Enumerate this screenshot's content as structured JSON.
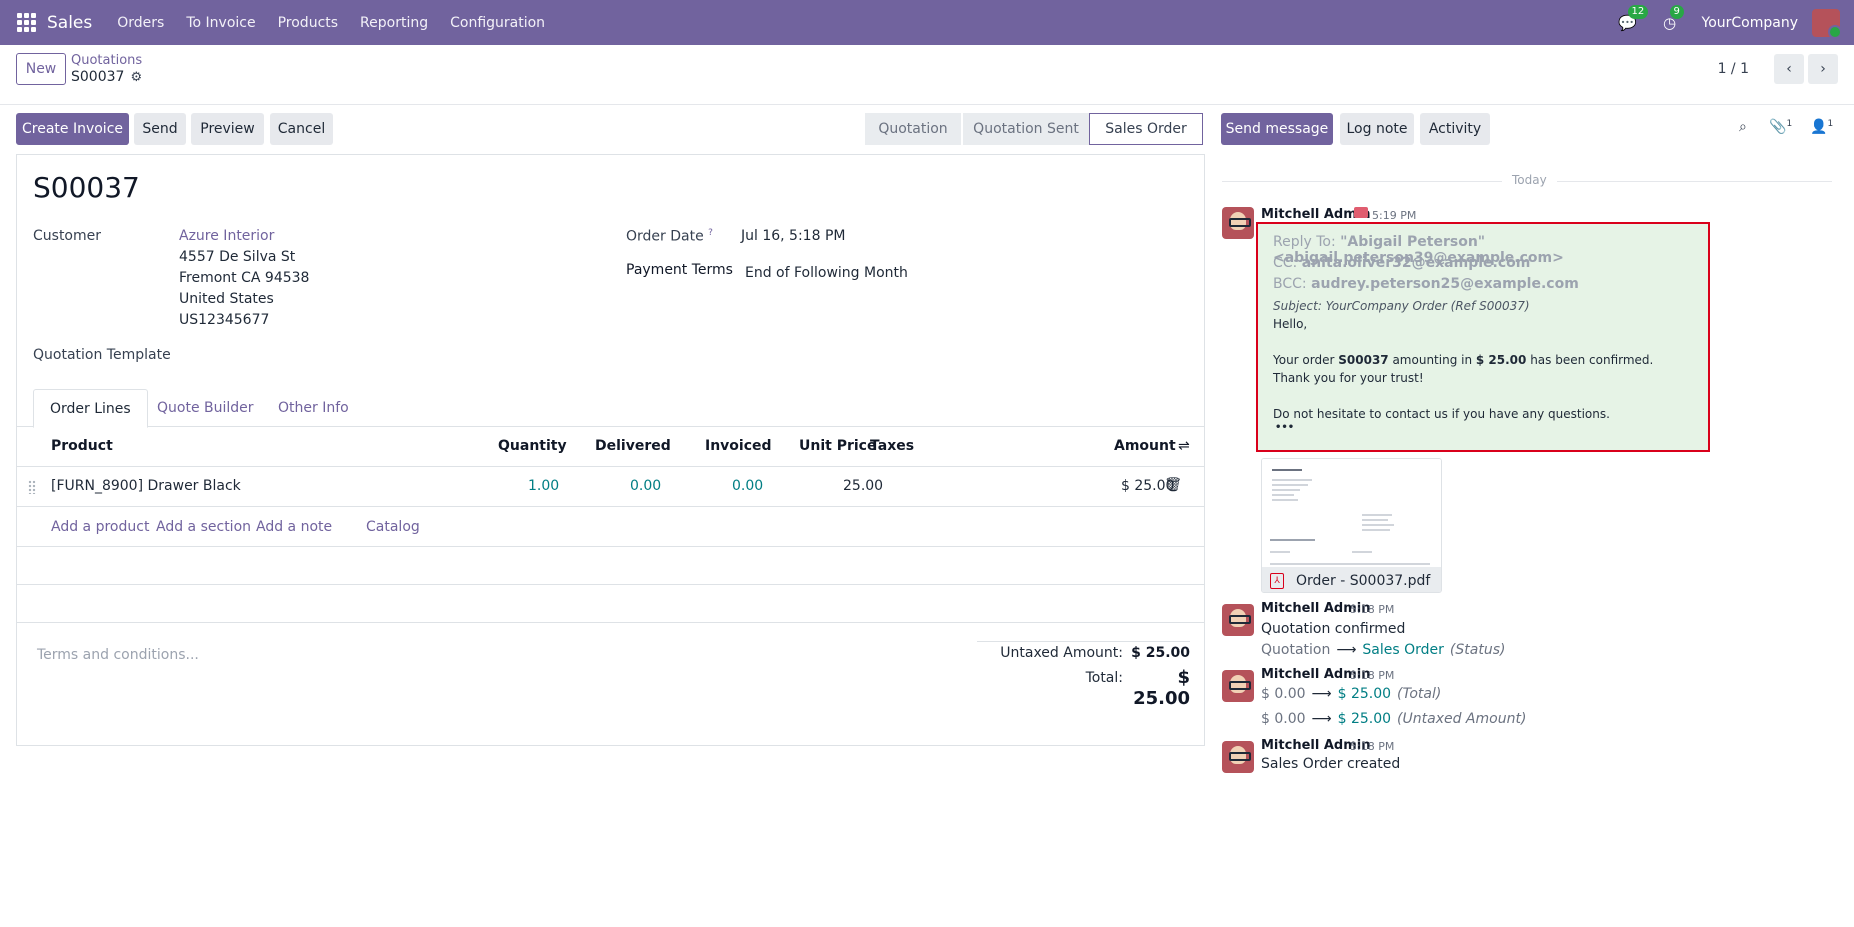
{
  "topbar": {
    "app_name": "Sales",
    "menu": [
      "Orders",
      "To Invoice",
      "Products",
      "Reporting",
      "Configuration"
    ],
    "messages_count": "12",
    "activities_count": "9",
    "company": "YourCompany"
  },
  "control": {
    "new_label": "New",
    "breadcrumb_parent": "Quotations",
    "breadcrumb_current": "S00037",
    "pager": "1 / 1"
  },
  "actions": {
    "create_invoice": "Create Invoice",
    "send": "Send",
    "preview": "Preview",
    "cancel": "Cancel"
  },
  "status": {
    "stages": [
      "Quotation",
      "Quotation Sent",
      "Sales Order"
    ],
    "active": "Sales Order"
  },
  "form": {
    "title": "S00037",
    "customer_label": "Customer",
    "customer_name": "Azure Interior",
    "address": [
      "4557 De Silva St",
      "Fremont CA 94538",
      "United States",
      "US12345677"
    ],
    "quotation_template_label": "Quotation Template",
    "order_date_label": "Order Date",
    "order_date_hint": "?",
    "order_date": "Jul 16, 5:18 PM",
    "payment_terms_label": "Payment Terms",
    "payment_terms": "End of Following Month"
  },
  "tabs": [
    "Order Lines",
    "Quote Builder",
    "Other Info"
  ],
  "order_lines": {
    "columns": [
      "Product",
      "Quantity",
      "Delivered",
      "Invoiced",
      "Unit Price",
      "Taxes",
      "Amount"
    ],
    "rows": [
      {
        "product": "[FURN_8900] Drawer Black",
        "quantity": "1.00",
        "delivered": "0.00",
        "invoiced": "0.00",
        "unit_price": "25.00",
        "taxes": "",
        "amount": "$ 25.00"
      }
    ],
    "add_links": [
      "Add a product",
      "Add a section",
      "Add a note",
      "Catalog"
    ]
  },
  "footer": {
    "terms_placeholder": "Terms and conditions...",
    "untaxed_label": "Untaxed Amount:",
    "untaxed_value": "$ 25.00",
    "total_label": "Total:",
    "total_value": "$ 25.00"
  },
  "chatter": {
    "send_message": "Send message",
    "log_note": "Log note",
    "activity": "Activity",
    "attachments_count": "1",
    "followers_count": "1",
    "today_label": "Today",
    "messages": [
      {
        "author": "Mitchell Admin",
        "time": "5:19 PM",
        "reply_to_label": "Reply To:",
        "reply_to": "\"Abigail Peterson\" <abigail.peterson39@example.com>",
        "cc_label": "CC:",
        "cc": "anita.oliver32@example.com",
        "bcc_label": "BCC:",
        "bcc": "audrey.peterson25@example.com",
        "subject": "Subject: YourCompany Order (Ref S00037)",
        "greeting": "Hello,",
        "line1_pre": "Your order ",
        "line1_order": "S00037",
        "line1_mid": " amounting in ",
        "line1_amount": "$ 25.00",
        "line1_post": " has been confirmed.",
        "line2": "Thank you for your trust!",
        "line3": "Do not hesitate to contact us if you have any questions.",
        "ellipsis": "•••",
        "attachment": "Order - S00037.pdf"
      },
      {
        "author": "Mitchell Admin",
        "time": "5:18 PM",
        "body": "Quotation confirmed",
        "track_old": "Quotation",
        "track_new": "Sales Order",
        "track_field": "(Status)"
      },
      {
        "author": "Mitchell Admin",
        "time": "5:18 PM",
        "tracks": [
          {
            "old": "$ 0.00",
            "new": "$ 25.00",
            "field": "(Total)"
          },
          {
            "old": "$ 0.00",
            "new": "$ 25.00",
            "field": "(Untaxed Amount)"
          }
        ]
      },
      {
        "author": "Mitchell Admin",
        "time": "5:18 PM",
        "body": "Sales Order created"
      }
    ]
  },
  "colors": {
    "brand": "#71639e",
    "link_teal": "#017e84",
    "highlight_border": "#d9001b",
    "mail_bg": "#e6f3e6"
  }
}
